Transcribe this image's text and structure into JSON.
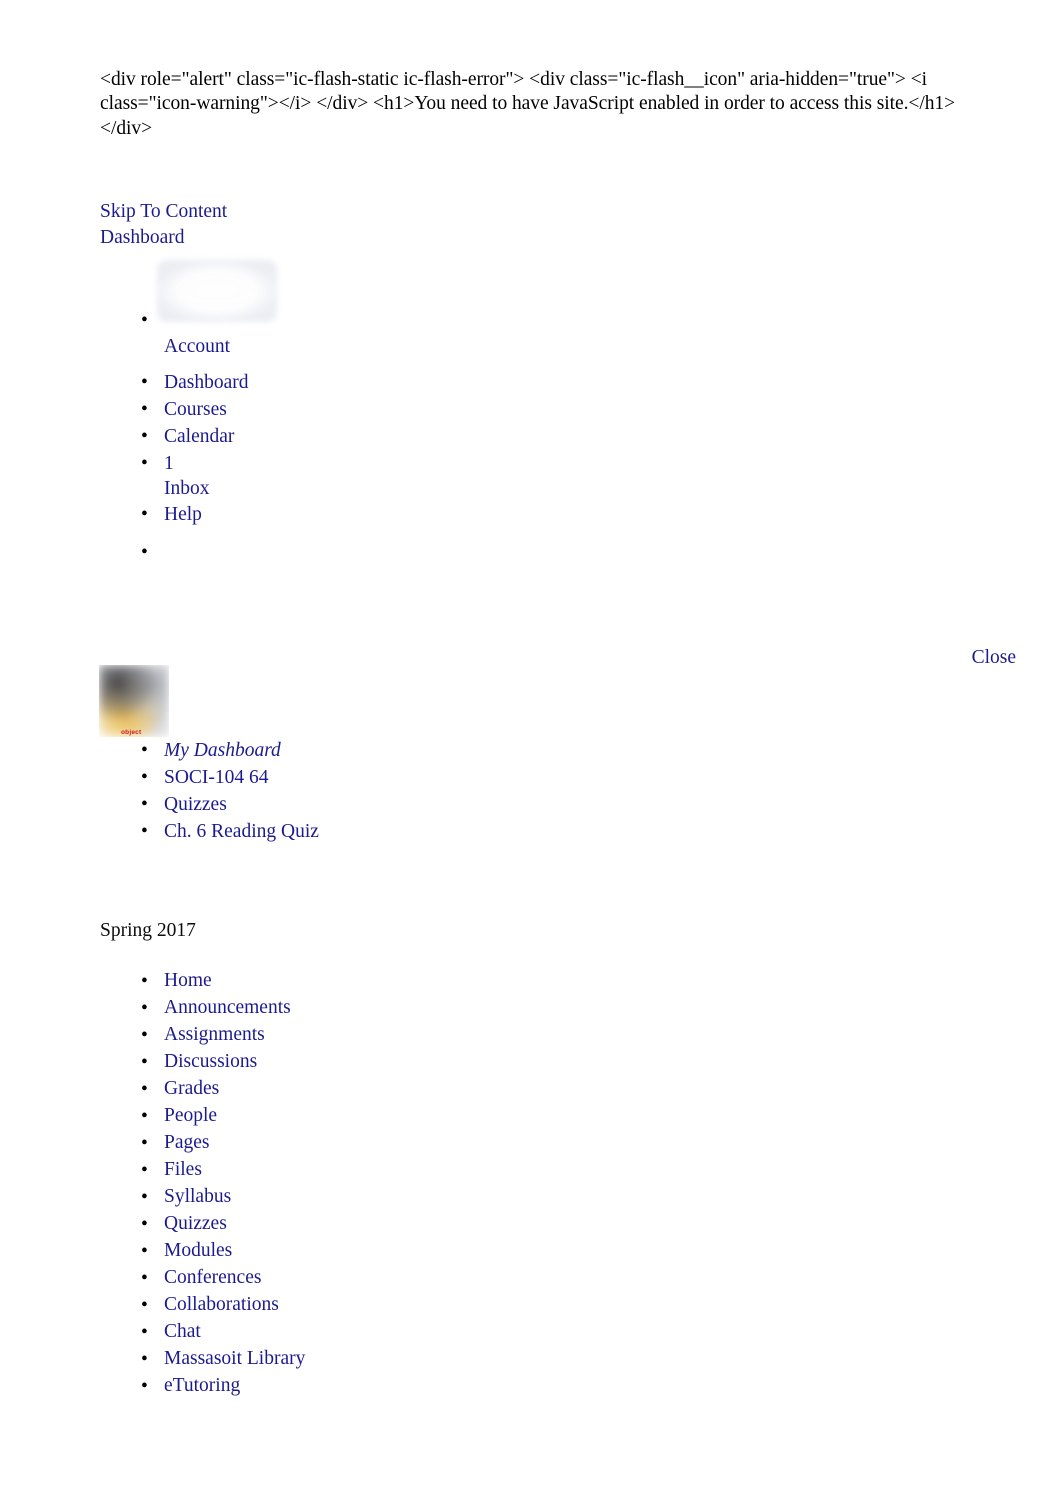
{
  "raw_markup_text": "<div role=\"alert\" class=\"ic-flash-static ic-flash-error\"> <div class=\"ic-flash__icon\" aria-hidden=\"true\"> <i class=\"icon-warning\"></i> </div> <h1>You need to have JavaScript enabled in order to access this site.</h1> </div>",
  "colors": {
    "link": "#1b1b8f",
    "text": "#000000",
    "broken_image_label": "#cc1b1b"
  },
  "top_links": {
    "skip_to_content": "Skip To Content",
    "dashboard": "Dashboard"
  },
  "global_nav": {
    "items": [
      {
        "label": "Account",
        "icon": "avatar-image-placeholder"
      },
      {
        "label": "Dashboard"
      },
      {
        "label": "Courses"
      },
      {
        "label": "Calendar"
      },
      {
        "label": "1",
        "sub_label": "Inbox"
      },
      {
        "label": "Help"
      }
    ],
    "empty_item": ""
  },
  "close_link": "Close",
  "course_image": {
    "alt_label": "object",
    "state": "broken-image"
  },
  "breadcrumb": {
    "items": [
      {
        "label": "My Dashboard",
        "style": "italic"
      },
      {
        "label": "SOCI-104 64"
      },
      {
        "label": "Quizzes"
      },
      {
        "label": "Ch. 6 Reading Quiz"
      }
    ]
  },
  "term": "Spring 2017",
  "course_nav": {
    "items": [
      "Home",
      "Announcements",
      "Assignments",
      "Discussions",
      "Grades",
      "People",
      "Pages",
      "Files",
      "Syllabus",
      "Quizzes",
      "Modules",
      "Conferences",
      "Collaborations",
      "Chat",
      "Massasoit Library",
      "eTutoring"
    ]
  }
}
